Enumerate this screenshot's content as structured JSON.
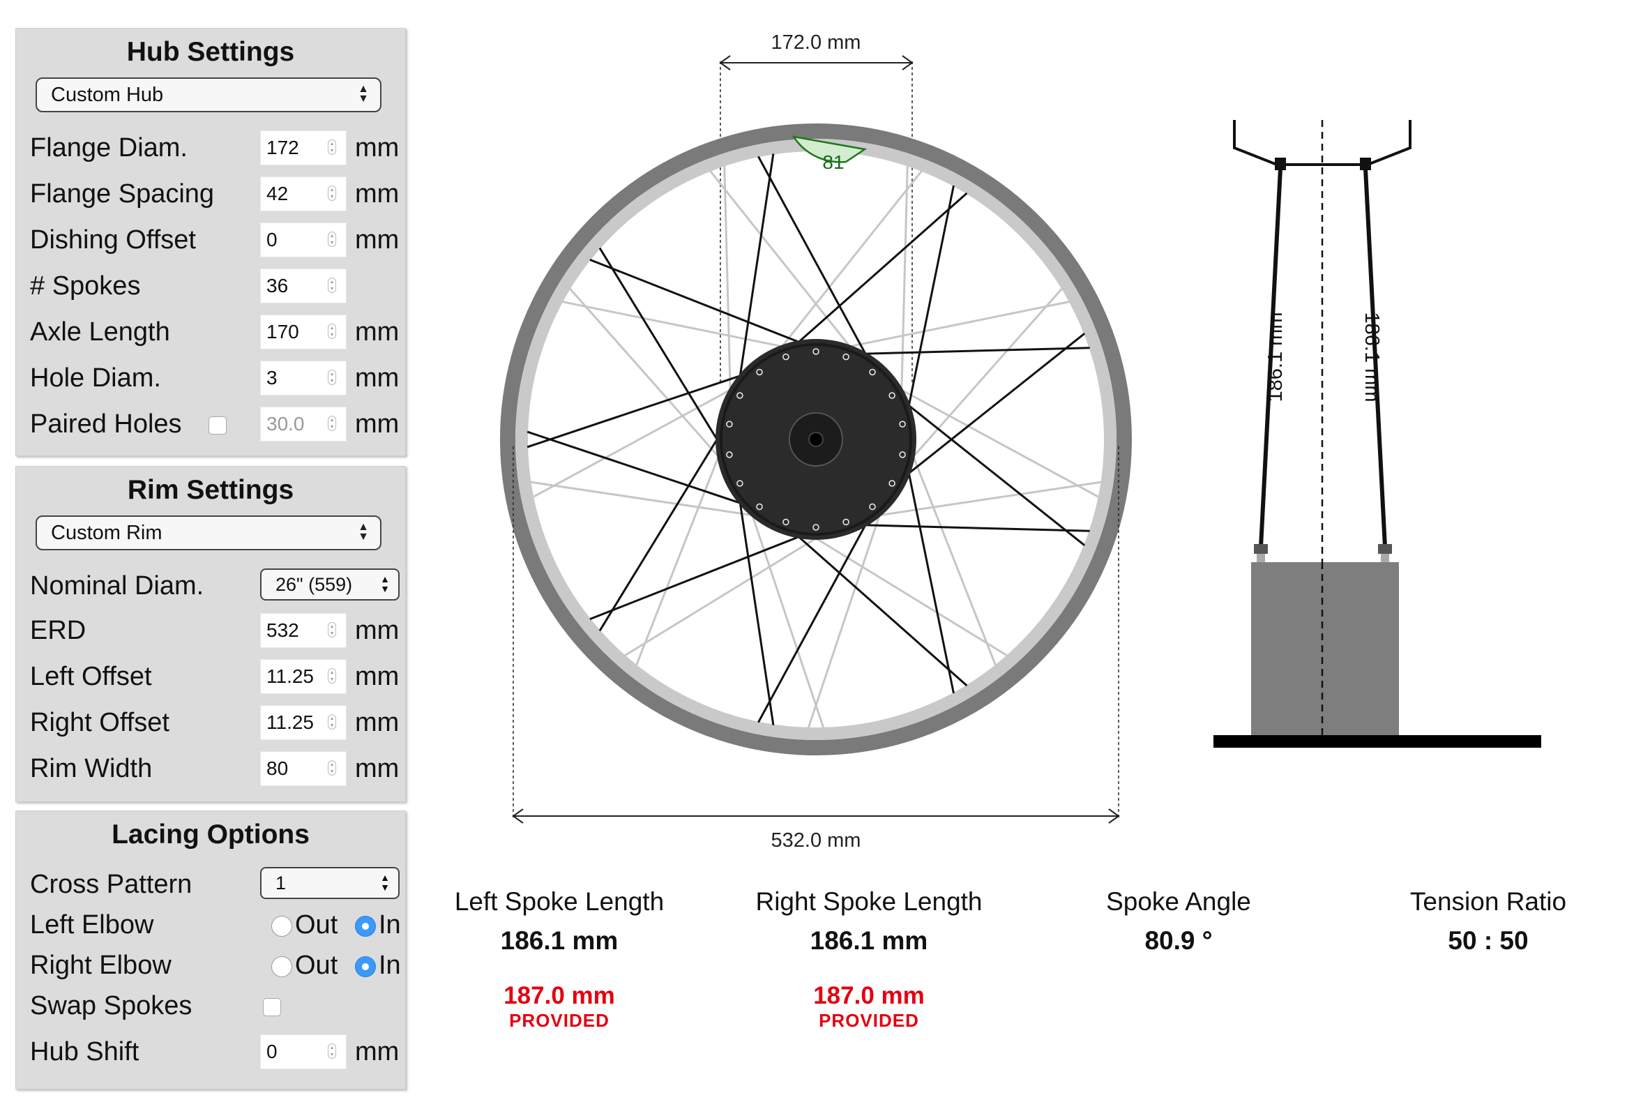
{
  "hub_settings": {
    "title": "Hub Settings",
    "hub_select": "Custom Hub",
    "fields": [
      {
        "label": "Flange Diam.",
        "value": "172",
        "unit": "mm"
      },
      {
        "label": "Flange Spacing",
        "value": "42",
        "unit": "mm"
      },
      {
        "label": "Dishing Offset",
        "value": "0",
        "unit": "mm"
      },
      {
        "label": "# Spokes",
        "value": "36",
        "unit": ""
      },
      {
        "label": "Axle Length",
        "value": "170",
        "unit": "mm"
      },
      {
        "label": "Hole Diam.",
        "value": "3",
        "unit": "mm"
      },
      {
        "label": "Paired Holes",
        "value": "30.0",
        "unit": "mm"
      }
    ]
  },
  "rim_settings": {
    "title": "Rim Settings",
    "rim_select": "Custom Rim",
    "nominal_label": "Nominal Diam.",
    "nominal_value": "26\" (559)",
    "fields": [
      {
        "label": "ERD",
        "value": "532",
        "unit": "mm"
      },
      {
        "label": "Left Offset",
        "value": "11.25",
        "unit": "mm"
      },
      {
        "label": "Right Offset",
        "value": "11.25",
        "unit": "mm"
      },
      {
        "label": "Rim Width",
        "value": "80",
        "unit": "mm"
      }
    ]
  },
  "lacing_options": {
    "title": "Lacing Options",
    "cross_label": "Cross Pattern",
    "cross_value": "1",
    "left_elbow_label": "Left Elbow",
    "right_elbow_label": "Right Elbow",
    "out_label": "Out",
    "in_label": "In",
    "swap_label": "Swap Spokes",
    "hub_shift_label": "Hub Shift",
    "hub_shift_value": "0",
    "hub_shift_unit": "mm"
  },
  "wheel_diagram": {
    "flange_dim": "172.0 mm",
    "erd_dim": "532.0 mm",
    "angle_label": "81",
    "colors": {
      "rim": "#7a7a7a",
      "rim_inner": "#c9c9c9",
      "hub": "#2a2a2a",
      "angle_fill": "#d4ecd0",
      "angle_line": "#1a7a1a"
    }
  },
  "side_diagram": {
    "left_len": "186.1 mm",
    "right_len": "186.1 mm"
  },
  "results": {
    "left": {
      "title": "Left Spoke Length",
      "value": "186.1 mm",
      "provided": "187.0 mm",
      "provided_label": "PROVIDED"
    },
    "right": {
      "title": "Right Spoke Length",
      "value": "186.1 mm",
      "provided": "187.0 mm",
      "provided_label": "PROVIDED"
    },
    "angle": {
      "title": "Spoke Angle",
      "value": "80.9 °"
    },
    "tension": {
      "title": "Tension Ratio",
      "value": "50 : 50"
    }
  }
}
